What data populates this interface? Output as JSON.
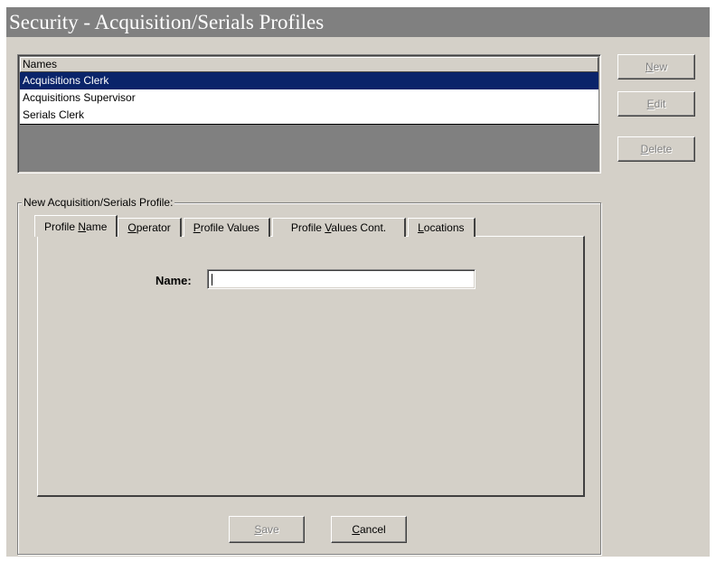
{
  "window": {
    "title": "Security - Acquisition/Serials Profiles"
  },
  "names_list": {
    "header": "Names",
    "items": [
      {
        "label": "Acquisitions Clerk",
        "selected": true
      },
      {
        "label": "Acquisitions Supervisor",
        "selected": false
      },
      {
        "label": "Serials Clerk",
        "selected": false
      }
    ]
  },
  "side_buttons": {
    "new": {
      "pre": "",
      "mnemonic": "N",
      "post": "ew",
      "enabled": false
    },
    "edit": {
      "pre": "",
      "mnemonic": "E",
      "post": "dit",
      "enabled": false
    },
    "delete": {
      "pre": "",
      "mnemonic": "D",
      "post": "elete",
      "enabled": false
    }
  },
  "profile_group": {
    "label": "New Acquisition/Serials Profile:",
    "tabs": [
      {
        "pre": "Profile ",
        "mnemonic": "N",
        "post": "ame",
        "active": true
      },
      {
        "pre": "",
        "mnemonic": "O",
        "post": "perator",
        "active": false
      },
      {
        "pre": "",
        "mnemonic": "P",
        "post": "rofile Values",
        "active": false
      },
      {
        "pre": "Profile ",
        "mnemonic": "V",
        "post": "alues Cont.",
        "active": false
      },
      {
        "pre": "",
        "mnemonic": "L",
        "post": "ocations",
        "active": false
      }
    ],
    "name_field": {
      "label": "Name:",
      "value": "",
      "placeholder": ""
    }
  },
  "actions": {
    "save": {
      "pre": "",
      "mnemonic": "S",
      "post": "ave",
      "enabled": false
    },
    "cancel": {
      "pre": "",
      "mnemonic": "C",
      "post": "ancel",
      "enabled": true
    }
  },
  "colors": {
    "face": "#d4d0c8",
    "title_bar": "#808080",
    "selection": "#0a246a",
    "disabled_text": "#808080"
  }
}
